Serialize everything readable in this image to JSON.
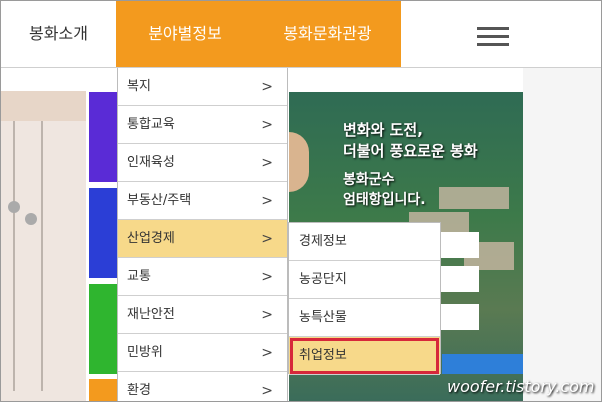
{
  "header": {
    "nav_intro": "봉화소개",
    "nav_field": "분야별정보",
    "nav_culture": "봉화문화관광"
  },
  "colors": {
    "accent": "#f39a1e",
    "highlight": "#f7d98a",
    "outline": "#d7283a"
  },
  "menu1": {
    "items": [
      {
        "label": "복지",
        "chevron": ">"
      },
      {
        "label": "통합교육",
        "chevron": ">"
      },
      {
        "label": "인재육성",
        "chevron": ">"
      },
      {
        "label": "부동산/주택",
        "chevron": ">"
      },
      {
        "label": "산업경제",
        "chevron": ">"
      },
      {
        "label": "교통",
        "chevron": ">"
      },
      {
        "label": "재난안전",
        "chevron": ">"
      },
      {
        "label": "민방위",
        "chevron": ">"
      },
      {
        "label": "환경",
        "chevron": ">"
      }
    ]
  },
  "menu2": {
    "items": [
      {
        "label": "경제정보"
      },
      {
        "label": "농공단지"
      },
      {
        "label": "농특산물"
      },
      {
        "label": "취업정보"
      }
    ]
  },
  "banner": {
    "line1": "변화와 도전,",
    "line2": "더불어 풍요로운 봉화",
    "line3": "봉화군수",
    "line4": "엄태항입니다."
  },
  "watermark": "woofer.tistory.com"
}
